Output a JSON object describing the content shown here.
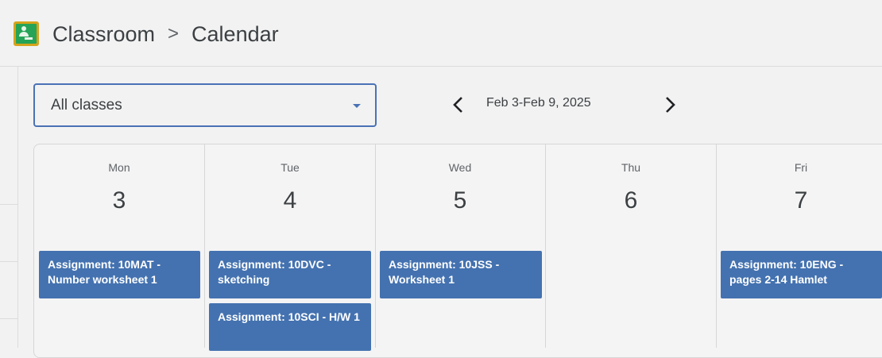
{
  "header": {
    "app_icon": "google-classroom-icon",
    "breadcrumb": {
      "root": "Classroom",
      "separator": ">",
      "current": "Calendar"
    }
  },
  "toolbar": {
    "class_filter": {
      "value": "All classes",
      "icon": "dropdown-arrow-icon"
    },
    "prev_icon": "chevron-left-icon",
    "next_icon": "chevron-right-icon",
    "date_range": "Feb 3-Feb 9, 2025"
  },
  "calendar": {
    "days": [
      {
        "name": "Mon",
        "date": "3"
      },
      {
        "name": "Tue",
        "date": "4"
      },
      {
        "name": "Wed",
        "date": "5"
      },
      {
        "name": "Thu",
        "date": "6"
      },
      {
        "name": "Fri",
        "date": "7"
      }
    ],
    "events": [
      {
        "day": "Mon",
        "title": "Assignment: 10MAT - Number worksheet 1"
      },
      {
        "day": "Tue",
        "title": "Assignment: 10DVC - sketching"
      },
      {
        "day": "Tue",
        "title": "Assignment: 10SCI - H/W 1"
      },
      {
        "day": "Wed",
        "title": "Assignment: 10JSS - Worksheet 1"
      },
      {
        "day": "Fri",
        "title": "Assignment: 10ENG - pages 2-14 Hamlet"
      }
    ]
  },
  "colors": {
    "event_bg": "#4472b0",
    "select_border": "#4a72b5",
    "page_bg": "#f2f2f2"
  }
}
